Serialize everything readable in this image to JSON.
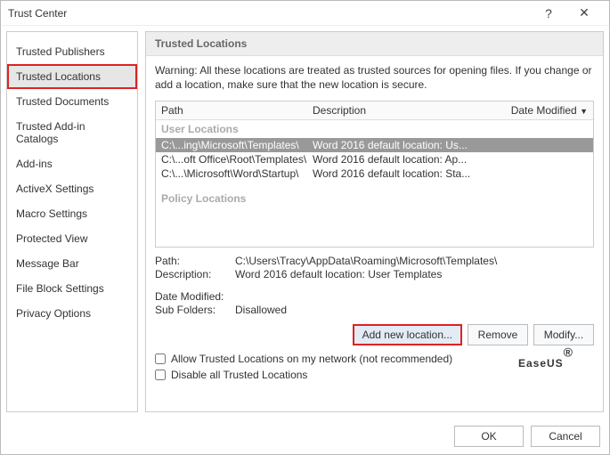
{
  "window": {
    "title": "Trust Center"
  },
  "sidebar": {
    "items": [
      {
        "label": "Trusted Publishers"
      },
      {
        "label": "Trusted Locations"
      },
      {
        "label": "Trusted Documents"
      },
      {
        "label": "Trusted Add-in Catalogs"
      },
      {
        "label": "Add-ins"
      },
      {
        "label": "ActiveX Settings"
      },
      {
        "label": "Macro Settings"
      },
      {
        "label": "Protected View"
      },
      {
        "label": "Message Bar"
      },
      {
        "label": "File Block Settings"
      },
      {
        "label": "Privacy Options"
      }
    ],
    "selected_index": 1
  },
  "panel": {
    "heading": "Trusted Locations",
    "warning": "Warning: All these locations are treated as trusted sources for opening files. If you change or add a location, make sure that the new location is secure.",
    "columns": {
      "path": "Path",
      "desc": "Description",
      "date": "Date Modified"
    },
    "sort_indicator": "▼",
    "groups": {
      "user": "User Locations",
      "policy": "Policy Locations"
    },
    "rows": [
      {
        "path": "C:\\...ing\\Microsoft\\Templates\\",
        "desc": "Word 2016 default location: Us...",
        "selected": true
      },
      {
        "path": "C:\\...oft Office\\Root\\Templates\\",
        "desc": "Word 2016 default location: Ap..."
      },
      {
        "path": "C:\\...\\Microsoft\\Word\\Startup\\",
        "desc": "Word 2016 default location: Sta..."
      }
    ],
    "details": {
      "path_label": "Path:",
      "path_value": "C:\\Users\\Tracy\\AppData\\Roaming\\Microsoft\\Templates\\",
      "desc_label": "Description:",
      "desc_value": "Word 2016 default location: User Templates",
      "date_label": "Date Modified:",
      "date_value": "",
      "sub_label": "Sub Folders:",
      "sub_value": "Disallowed"
    },
    "buttons": {
      "add": "Add new location...",
      "remove": "Remove",
      "modify": "Modify..."
    },
    "checkboxes": {
      "network": "Allow Trusted Locations on my network (not recommended)",
      "disable": "Disable all Trusted Locations"
    }
  },
  "footer": {
    "ok": "OK",
    "cancel": "Cancel"
  },
  "watermark": "EaseUS"
}
